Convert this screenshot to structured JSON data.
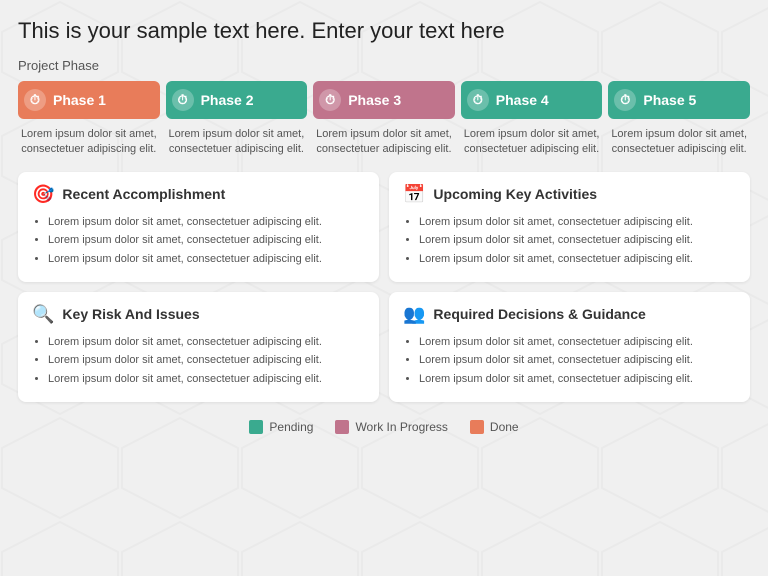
{
  "title": "This is your sample text here. Enter your text here",
  "project_phase_label": "Project Phase",
  "phases": [
    {
      "label": "Phase 1",
      "status": "done",
      "status_class": "done",
      "icon": "⏱",
      "description": "Lorem ipsum dolor sit amet, consectetuer adipiscing elit."
    },
    {
      "label": "Phase 2",
      "status": "pending",
      "status_class": "pending",
      "icon": "⏱",
      "description": "Lorem ipsum dolor sit amet, consectetuer adipiscing elit."
    },
    {
      "label": "Phase 3",
      "status": "wip",
      "status_class": "wip",
      "icon": "⏱",
      "description": "Lorem ipsum dolor sit amet, consectetuer adipiscing elit."
    },
    {
      "label": "Phase 4",
      "status": "pending",
      "status_class": "pending",
      "icon": "⏱",
      "description": "Lorem ipsum dolor sit amet, consectetuer adipiscing elit."
    },
    {
      "label": "Phase 5",
      "status": "pending",
      "status_class": "pending",
      "icon": "⏱",
      "description": "Lorem ipsum dolor sit amet, consectetuer adipiscing elit."
    }
  ],
  "accomplishment": {
    "title": "Recent Accomplishment",
    "icon": "🎯",
    "items": [
      "Lorem ipsum dolor sit amet, consectetuer adipiscing elit.",
      "Lorem ipsum dolor sit amet, consectetuer adipiscing elit.",
      "Lorem ipsum dolor sit amet, consectetuer adipiscing elit."
    ]
  },
  "activities": {
    "title": "Upcoming Key Activities",
    "icon": "📅",
    "items": [
      "Lorem ipsum dolor sit amet, consectetuer adipiscing elit.",
      "Lorem ipsum dolor sit amet, consectetuer adipiscing elit.",
      "Lorem ipsum dolor sit amet, consectetuer adipiscing elit."
    ]
  },
  "risks": {
    "title": "Key Risk And Issues",
    "icon": "🔍",
    "items": [
      "Lorem ipsum dolor sit amet, consectetuer adipiscing elit.",
      "Lorem ipsum dolor sit amet, consectetuer adipiscing elit.",
      "Lorem ipsum dolor sit amet, consectetuer adipiscing elit."
    ]
  },
  "decisions": {
    "title": "Required Decisions & Guidance",
    "icon": "👥",
    "items": [
      "Lorem ipsum dolor sit amet, consectetuer adipiscing elit.",
      "Lorem ipsum dolor sit amet, consectetuer adipiscing elit.",
      "Lorem ipsum dolor sit amet, consectetuer adipiscing elit."
    ]
  },
  "legend": [
    {
      "label": "Pending",
      "color": "#3aaa8f"
    },
    {
      "label": "Work In Progress",
      "color": "#c0748c"
    },
    {
      "label": "Done",
      "color": "#e87c5a"
    }
  ]
}
